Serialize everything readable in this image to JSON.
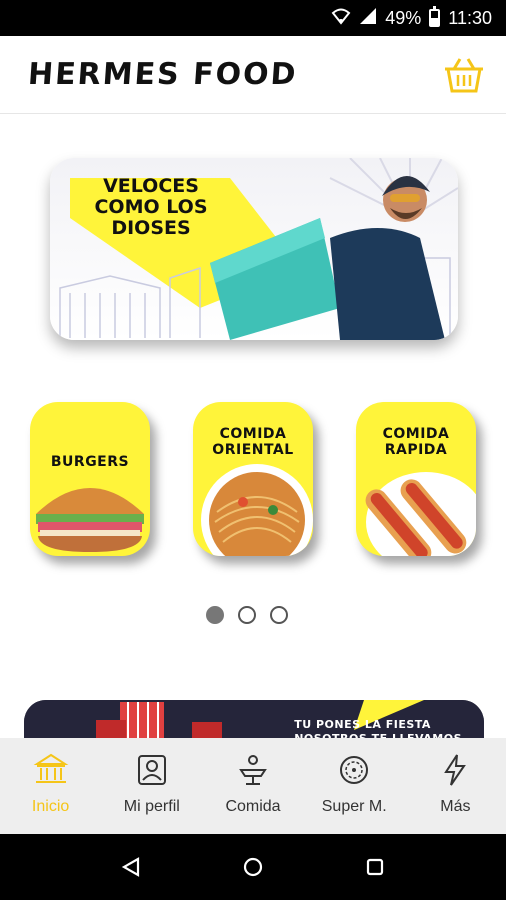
{
  "status_bar": {
    "battery": "49%",
    "time": "11:30",
    "battery_level": 0.49
  },
  "header": {
    "brand": "HERMES FOOD",
    "cart_icon": "basket-icon",
    "accent_color": "#f5c518"
  },
  "hero": {
    "line1": "VELOCES",
    "line2": "COMO LOS",
    "line3": "DIOSES",
    "accent_color": "#fff43a"
  },
  "categories": [
    {
      "label": "BURGERS",
      "icon": "burger-image"
    },
    {
      "label_line1": "COMIDA",
      "label_line2": "ORIENTAL",
      "icon": "noodles-image"
    },
    {
      "label_line1": "COMIDA",
      "label_line2": "RAPIDA",
      "icon": "hotdog-image"
    }
  ],
  "carousel": {
    "page_count": 3,
    "active_index": 0
  },
  "promo": {
    "line1": "TU PONES LA FIESTA",
    "line2": "NOSOTROS TE LLEVAMOS"
  },
  "bottom_nav": [
    {
      "label": "Inicio",
      "icon": "temple-icon",
      "active": true
    },
    {
      "label": "Mi perfil",
      "icon": "profile-icon",
      "active": false
    },
    {
      "label": "Comida",
      "icon": "dish-icon",
      "active": false
    },
    {
      "label": "Super M.",
      "icon": "market-icon",
      "active": false
    },
    {
      "label": "Más",
      "icon": "lightning-icon",
      "active": false
    }
  ],
  "system_nav": {
    "back": "back-icon",
    "home": "home-icon",
    "recents": "recents-icon"
  }
}
